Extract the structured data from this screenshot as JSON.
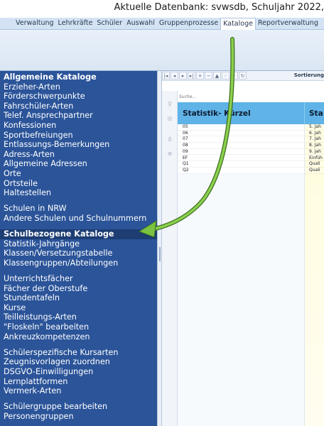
{
  "header": {
    "title": "Aktuelle Datenbank: svwsdb, Schuljahr 2022,"
  },
  "menu": {
    "items": [
      "Verwaltung",
      "Lehrkräfte",
      "Schüler",
      "Auswahl",
      "Gruppenprozesse",
      "Kataloge",
      "Reportverwaltung"
    ],
    "active_index": 5
  },
  "sidebar": {
    "group1": {
      "heading": "Allgemeine Kataloge",
      "items": [
        "Erzieher-Arten",
        "Förderschwerpunkte",
        "Fahrschüler-Arten",
        "Telef. Ansprechpartner",
        "Konfessionen",
        "Sportbefreiungen",
        "Entlassungs-Bemerkungen",
        "Adress-Arten",
        "Allgemeine Adressen",
        "Orte",
        "Ortsteile",
        "Haltestellen"
      ]
    },
    "group2": {
      "items": [
        "Schulen in NRW",
        "Andere Schulen und Schulnummern"
      ]
    },
    "group3": {
      "heading": "Schulbezogene Kataloge",
      "items": [
        "Statistik-Jahrgänge",
        "Klassen/Versetzungstabelle",
        "Klassengruppen/Abteilungen"
      ]
    },
    "group4": {
      "items": [
        "Unterrichtsfächer",
        "Fächer der Oberstufe",
        "Stundentafeln",
        "Kurse",
        "Teilleistungs-Arten",
        "\"Floskeln\" bearbeiten",
        "Ankreuzkompetenzen"
      ]
    },
    "group5": {
      "items": [
        "Schülerspezifische Kursarten",
        "Zeugnisvorlagen zuordnen",
        "DSGVO-Einwilligungen",
        "Lernplattformen",
        "Vermerk-Arten"
      ]
    },
    "group6": {
      "items": [
        "Schülergruppe bearbeiten",
        "Personengruppen"
      ]
    }
  },
  "toolbar": {
    "nav_buttons": [
      "|◂",
      "◂",
      "▸",
      "▸|",
      "+",
      "−",
      "▲",
      "✓",
      "✕",
      "↻"
    ],
    "sort_label": "Sortierung"
  },
  "search": {
    "placeholder": "Suche..."
  },
  "grid": {
    "columns": [
      "Statistik- Kürzel",
      "Sta"
    ],
    "rows": [
      [
        "05",
        "5. Jah"
      ],
      [
        "06",
        "6. Jah"
      ],
      [
        "07",
        "7. Jah"
      ],
      [
        "08",
        "8. Jah"
      ],
      [
        "09",
        "9. Jah"
      ],
      [
        "EF",
        "Einfüh"
      ],
      [
        "Q1",
        "Quali"
      ],
      [
        "Q2",
        "Quali"
      ]
    ]
  },
  "colors": {
    "sidebar_bg": "#2b5499",
    "sidebar_selected": "#1d3d73",
    "grid_header": "#5fb3e7",
    "arrow": "#7cc242"
  }
}
